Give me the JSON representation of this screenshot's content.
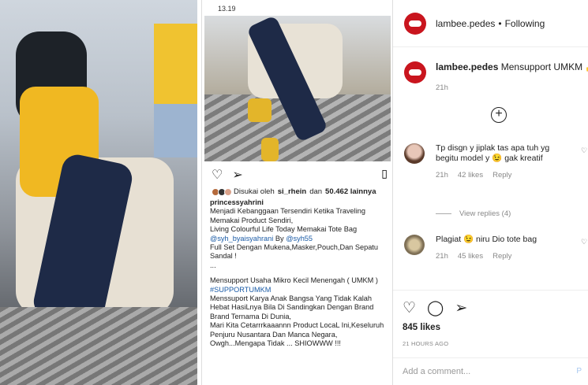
{
  "phone": {
    "status_time": "13.19",
    "liked_by_prefix": "Disukai oleh",
    "liked_by_user": "si_rhein",
    "liked_by_middle": "dan",
    "liked_by_count": "50.462 lainnya",
    "caption_user": "princessyahrini",
    "caption_lines": [
      "Menjadi Kebanggaan Tersendiri Ketika Traveling",
      "Memakai Product Sendiri,",
      "Living Colourful Life Today Memakai Tote Bag"
    ],
    "caption_mention1": "@syh_byaisyahrani",
    "caption_by": "By",
    "caption_mention2": "@syh55",
    "caption_lines2": [
      "Full Set Dengan Mukena,Masker,Pouch,Dan Sepatu",
      "Sandal !",
      "..."
    ],
    "caption_lines3": [
      "Mensupport Usaha Mikro Kecil Menengah ( UMKM )"
    ],
    "caption_hashtag": "#SUPPORTUMKM",
    "caption_lines4": [
      "Menssuport Karya Anak Bangsa Yang Tidak Kalah",
      "Hebat HasiLnya Bila Di Sandingkan Dengan Brand",
      "Brand Ternama Di Dunia,",
      "Mari Kita Cetarrrkaaannn Product LocaL Ini,Keseluruh",
      "Penjuru Nusantara Dan Manca Negara,",
      "Owgh...Mengapa Tidak ... SHIOWWW !!!"
    ]
  },
  "ig": {
    "username": "lambee.pedes",
    "separator": "•",
    "following": "Following",
    "main_comment_user": "lambee.pedes",
    "main_comment_text": "Mensupport UMKM 👍",
    "main_comment_time": "21h",
    "comments": [
      {
        "text": "Tp disgn y jiplak tas apa tuh yg begitu model y 😉 gak kreatif",
        "time": "21h",
        "likes": "42 likes",
        "reply": "Reply"
      },
      {
        "text": "Plagiat 😉 niru Dio tote bag",
        "time": "21h",
        "likes": "45 likes",
        "reply": "Reply"
      }
    ],
    "view_replies": "View replies (4)",
    "likes_count": "845 likes",
    "posted": "21 HOURS AGO",
    "add_comment_placeholder": "Add a comment...",
    "post_label": "P"
  }
}
